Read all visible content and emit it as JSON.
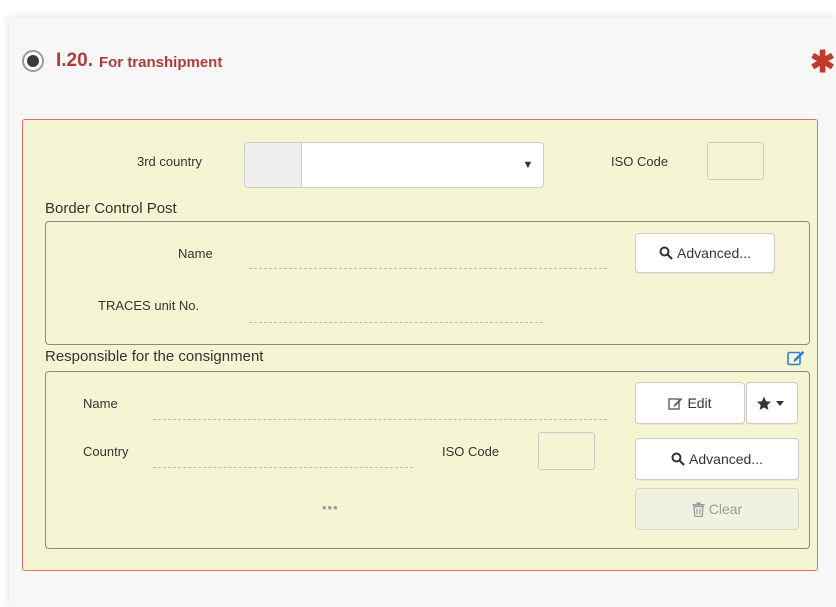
{
  "section": {
    "number": "I.20.",
    "title": "For transhipment",
    "required_marker": "✱",
    "radio_selected": true
  },
  "third_country": {
    "label": "3rd country",
    "value": "",
    "iso_label": "ISO Code",
    "iso_value": ""
  },
  "border_control_post": {
    "title": "Border Control Post",
    "name_label": "Name",
    "name_value": "",
    "unit_label": "TRACES unit No.",
    "unit_value": "",
    "advanced_button": "Advanced..."
  },
  "responsible": {
    "title": "Responsible for the consignment",
    "name_label": "Name",
    "name_value": "",
    "country_label": "Country",
    "country_value": "",
    "iso_label": "ISO Code",
    "iso_value": "",
    "ellipsis": "•••",
    "edit_button": "Edit",
    "advanced_button": "Advanced...",
    "clear_button": "Clear"
  },
  "colors": {
    "accent_red": "#b03a3a",
    "panel_bg": "#f6f5d3",
    "panel_border": "#e36b6b",
    "icon_blue": "#2a7fd4"
  }
}
